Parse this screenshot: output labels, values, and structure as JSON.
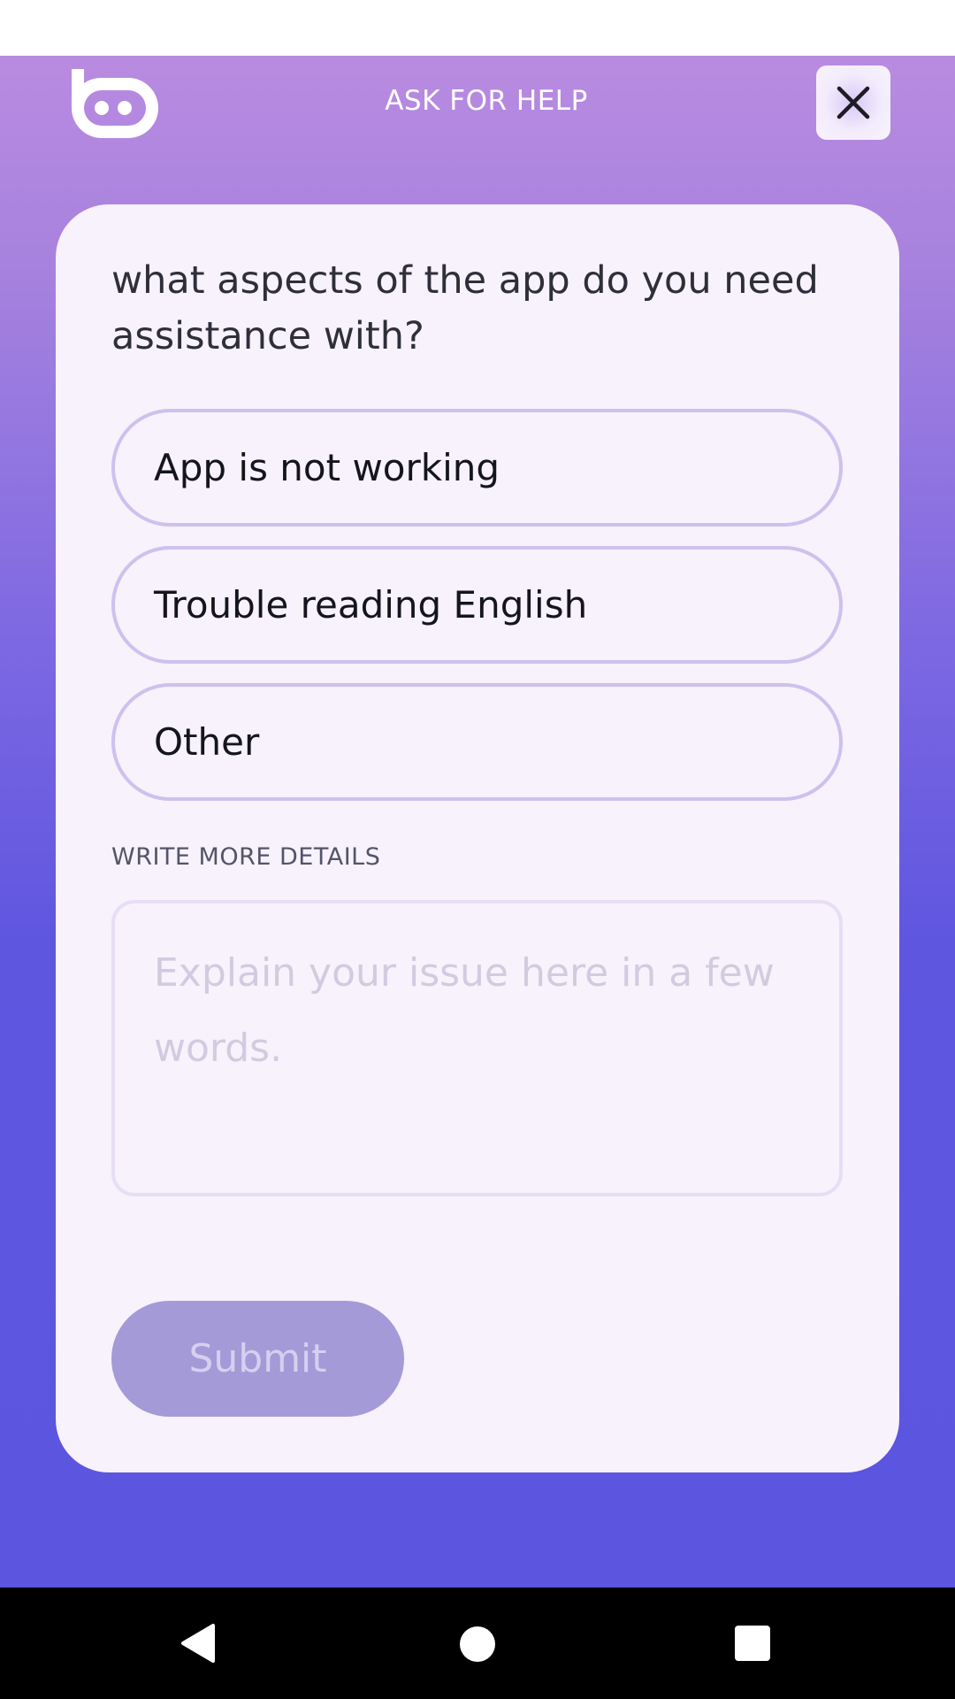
{
  "header": {
    "title": "ASK FOR HELP",
    "logo_icon": "app-logo-icon",
    "close_icon": "close-icon"
  },
  "form": {
    "question": "what aspects of the app do you need assistance with?",
    "options": [
      {
        "label": "App is not working"
      },
      {
        "label": "Trouble reading English"
      },
      {
        "label": "Other"
      }
    ],
    "details_label": "WRITE MORE DETAILS",
    "details_value": "",
    "details_placeholder": "Explain your issue here in a few words.",
    "submit_label": "Submit",
    "submit_enabled": false
  },
  "navigation": {
    "back_icon": "back-triangle-icon",
    "home_icon": "home-circle-icon",
    "recents_icon": "recents-square-icon"
  },
  "colors": {
    "gradient_top": "#b98be0",
    "gradient_bottom": "#5b55df",
    "card_background": "#f7f2fb",
    "option_border": "#cbc2ee",
    "submit_disabled": "#a59ad8"
  }
}
